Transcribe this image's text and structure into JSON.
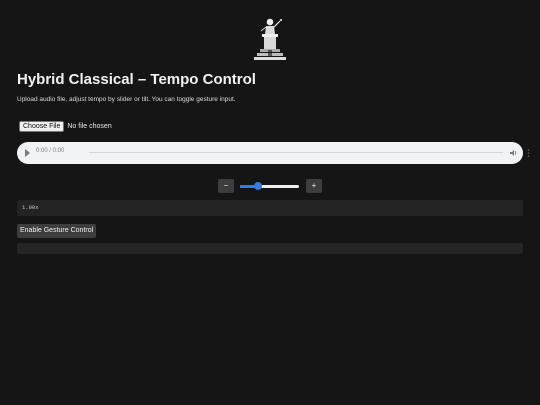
{
  "app": {
    "title": "Hybrid Classical – Tempo Control",
    "subtitle": "Upload audio file, adjust tempo by slider or tilt. You can toggle gesture input."
  },
  "logo": {
    "icon": "conductor-podium-icon"
  },
  "file_input": {
    "button_label": "Choose File",
    "status": "No file chosen"
  },
  "audio_player": {
    "time": "0:00 / 0:00",
    "play_icon": "play-icon",
    "volume_icon": "volume-icon",
    "more_icon": "more-vertical-icon",
    "progress": 0
  },
  "tempo": {
    "minus_label": "−",
    "plus_label": "+",
    "slider_level": 0.31,
    "value": "1.00x",
    "accent_color": "#2f7fe6"
  },
  "gesture": {
    "button_label": "Enable Gesture Control",
    "status": ""
  }
}
